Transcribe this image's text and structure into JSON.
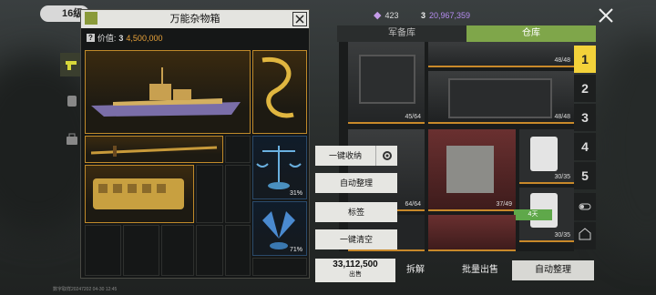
{
  "header": {
    "level": "16级",
    "gems": "423",
    "coins": "20,967,359"
  },
  "popup": {
    "title": "万能杂物箱",
    "value_label": "价值:",
    "value_amount": "4,500,000",
    "items": [
      {
        "name": "destroyer-ship-model",
        "rarity": "gold"
      },
      {
        "name": "golden-ribbon",
        "rarity": "gold"
      },
      {
        "name": "katana-sword",
        "rarity": "gold"
      },
      {
        "name": "balance-scale",
        "rarity": "blue",
        "percent": "31%"
      },
      {
        "name": "golden-train-car",
        "rarity": "gold"
      },
      {
        "name": "crystal-butterfly",
        "rarity": "blue",
        "percent": "71%"
      }
    ]
  },
  "tabs": {
    "armory": "军备库",
    "warehouse": "仓库"
  },
  "storage": {
    "crates": [
      {
        "count": "48/48"
      },
      {
        "count": "45/64"
      },
      {
        "count": "48/48"
      },
      {
        "count": "64/64"
      },
      {
        "count": "37/49"
      },
      {
        "count": "30/35"
      },
      {
        "count": "30/35",
        "badge": "4天"
      }
    ],
    "page_tabs": [
      "1",
      "2",
      "3",
      "4",
      "5"
    ]
  },
  "context_menu": {
    "collect_all": "一键收纳",
    "auto_sort": "自动整理",
    "tag": "标签",
    "clear_all": "一键清空"
  },
  "footer": {
    "sell_value": "3,112,500",
    "sell_label": "出售",
    "dismantle": "拆解",
    "bulk_sell": "批量出售",
    "auto_sort": "自动整理",
    "watermark": "数字取样20247202 04-30 12:45"
  },
  "colors": {
    "gold": "#c08a2a",
    "tab_active": "#7fa64a",
    "page_active": "#f3d23a"
  }
}
